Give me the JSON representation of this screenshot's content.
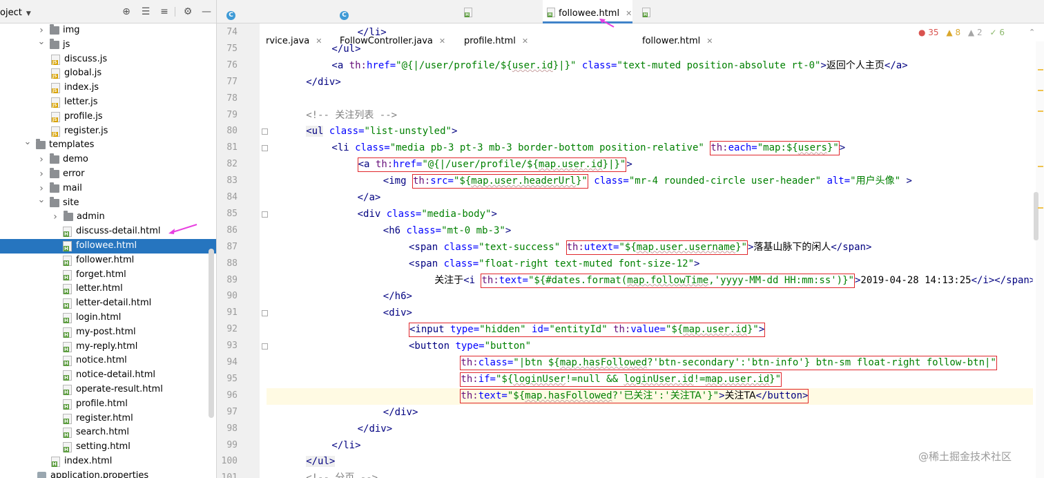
{
  "project_pane": {
    "title": "oject",
    "tree": [
      {
        "label": "img",
        "type": "folder",
        "level": 3,
        "expanded": false
      },
      {
        "label": "js",
        "type": "folder",
        "level": 3,
        "expanded": true
      },
      {
        "label": "discuss.js",
        "type": "js",
        "level": 4
      },
      {
        "label": "global.js",
        "type": "js",
        "level": 4
      },
      {
        "label": "index.js",
        "type": "js",
        "level": 4
      },
      {
        "label": "letter.js",
        "type": "js",
        "level": 4
      },
      {
        "label": "profile.js",
        "type": "js",
        "level": 4
      },
      {
        "label": "register.js",
        "type": "js",
        "level": 4
      },
      {
        "label": "templates",
        "type": "folder",
        "level": 2,
        "expanded": true
      },
      {
        "label": "demo",
        "type": "folder",
        "level": 3,
        "expanded": false
      },
      {
        "label": "error",
        "type": "folder",
        "level": 3,
        "expanded": false
      },
      {
        "label": "mail",
        "type": "folder",
        "level": 3,
        "expanded": false
      },
      {
        "label": "site",
        "type": "folder",
        "level": 3,
        "expanded": true
      },
      {
        "label": "admin",
        "type": "folder",
        "level": 4,
        "expanded": false
      },
      {
        "label": "discuss-detail.html",
        "type": "html",
        "level": 5
      },
      {
        "label": "followee.html",
        "type": "html",
        "level": 5,
        "selected": true
      },
      {
        "label": "follower.html",
        "type": "html",
        "level": 5
      },
      {
        "label": "forget.html",
        "type": "html",
        "level": 5
      },
      {
        "label": "letter.html",
        "type": "html",
        "level": 5
      },
      {
        "label": "letter-detail.html",
        "type": "html",
        "level": 5
      },
      {
        "label": "login.html",
        "type": "html",
        "level": 5
      },
      {
        "label": "my-post.html",
        "type": "html",
        "level": 5
      },
      {
        "label": "my-reply.html",
        "type": "html",
        "level": 5
      },
      {
        "label": "notice.html",
        "type": "html",
        "level": 5
      },
      {
        "label": "notice-detail.html",
        "type": "html",
        "level": 5
      },
      {
        "label": "operate-result.html",
        "type": "html",
        "level": 5
      },
      {
        "label": "profile.html",
        "type": "html",
        "level": 5
      },
      {
        "label": "register.html",
        "type": "html",
        "level": 5
      },
      {
        "label": "search.html",
        "type": "html",
        "level": 5
      },
      {
        "label": "setting.html",
        "type": "html",
        "level": 5
      },
      {
        "label": "index.html",
        "type": "html",
        "level": 4
      },
      {
        "label": "application.properties",
        "type": "properties",
        "level": 3
      }
    ]
  },
  "tabs": [
    {
      "label": "FollowService.java",
      "kind": "class"
    },
    {
      "label": "FollowController.java",
      "kind": "class"
    },
    {
      "label": "profile.html",
      "kind": "html"
    },
    {
      "label": "followee.html",
      "kind": "html",
      "active": true
    },
    {
      "label": "follower.html",
      "kind": "html"
    }
  ],
  "inspections": {
    "errors": "35",
    "warnings": "8",
    "weak_warnings": "2",
    "typos": "6"
  },
  "editor": {
    "current_line": "96",
    "lines": [
      {
        "n": "74",
        "indent": 3,
        "tokens": [
          [
            "tag",
            "</li>"
          ]
        ]
      },
      {
        "n": "75",
        "indent": 2,
        "tokens": [
          [
            "tag",
            "</ul>"
          ]
        ]
      },
      {
        "n": "76",
        "indent": 2,
        "tokens": [
          [
            "tag",
            "<a "
          ],
          [
            "thattr",
            "th:"
          ],
          [
            "attr",
            "href="
          ],
          [
            "str",
            "\"@{|/user/profile/${"
          ],
          [
            "str-w",
            "user.id"
          ],
          [
            "str",
            "}|}\""
          ],
          [
            "plain",
            " "
          ],
          [
            "attr",
            "class="
          ],
          [
            "str",
            "\"text-muted position-absolute rt-0\""
          ],
          [
            "tag",
            ">"
          ],
          [
            "zh",
            "返回个人主页"
          ],
          [
            "tag",
            "</a>"
          ]
        ]
      },
      {
        "n": "77",
        "indent": 1,
        "tokens": [
          [
            "tag",
            "</div>"
          ]
        ]
      },
      {
        "n": "78",
        "indent": 0,
        "tokens": []
      },
      {
        "n": "79",
        "indent": 1,
        "tokens": [
          [
            "cmt",
            "<!-- "
          ],
          [
            "cmtzh",
            "关注列表"
          ],
          [
            "cmt",
            " -->"
          ]
        ]
      },
      {
        "n": "80",
        "indent": 1,
        "tokens": [
          [
            "tagbg",
            "<ul"
          ],
          [
            "plain",
            " "
          ],
          [
            "attr",
            "class="
          ],
          [
            "str",
            "\"list-unstyled\""
          ],
          [
            "tag",
            ">"
          ]
        ]
      },
      {
        "n": "81",
        "indent": 2,
        "tokens": [
          [
            "tag",
            "<li "
          ],
          [
            "attr",
            "class="
          ],
          [
            "str",
            "\"media pb-3 pt-3 mb-3 border-bottom position-relative\""
          ],
          [
            "plain",
            " "
          ],
          [
            "hl",
            [
              [
                "thattr",
                "th:"
              ],
              [
                "attr",
                "each="
              ],
              [
                "str",
                "\"map:${"
              ],
              [
                "str-w",
                "users"
              ],
              [
                "str",
                "}\""
              ]
            ]
          ],
          [
            "tag",
            ">"
          ]
        ]
      },
      {
        "n": "82",
        "indent": 3,
        "tokens": [
          [
            "hl",
            [
              [
                "tag",
                "<a "
              ],
              [
                "thattr",
                "th:"
              ],
              [
                "attr",
                "href="
              ],
              [
                "str",
                "\"@{|/user/profile/${"
              ],
              [
                "str-w",
                "map.user.id"
              ],
              [
                "str",
                "}|}\""
              ]
            ]
          ],
          [
            "tag",
            ">"
          ]
        ]
      },
      {
        "n": "83",
        "indent": 4,
        "tokens": [
          [
            "tag",
            "<img "
          ],
          [
            "hl",
            [
              [
                "thattr",
                "th:"
              ],
              [
                "attr",
                "src="
              ],
              [
                "str",
                "\"${"
              ],
              [
                "str-w",
                "map.user.headerUrl"
              ],
              [
                "str",
                "}\""
              ]
            ]
          ],
          [
            "plain",
            " "
          ],
          [
            "attr",
            "class="
          ],
          [
            "str",
            "\"mr-4 rounded-circle user-header\""
          ],
          [
            "plain",
            " "
          ],
          [
            "attr",
            "alt="
          ],
          [
            "str",
            "\""
          ],
          [
            "strzh",
            "用户头像"
          ],
          [
            "str",
            "\""
          ],
          [
            "plain",
            " "
          ],
          [
            "tag",
            ">"
          ]
        ]
      },
      {
        "n": "84",
        "indent": 3,
        "tokens": [
          [
            "tag",
            "</a>"
          ]
        ]
      },
      {
        "n": "85",
        "indent": 3,
        "tokens": [
          [
            "tag",
            "<div "
          ],
          [
            "attr",
            "class="
          ],
          [
            "str",
            "\"media-body\""
          ],
          [
            "tag",
            ">"
          ]
        ]
      },
      {
        "n": "86",
        "indent": 4,
        "tokens": [
          [
            "tag",
            "<h6 "
          ],
          [
            "attr",
            "class="
          ],
          [
            "str",
            "\"mt-0 mb-3\""
          ],
          [
            "tag",
            ">"
          ]
        ]
      },
      {
        "n": "87",
        "indent": 5,
        "tokens": [
          [
            "tag",
            "<span "
          ],
          [
            "attr",
            "class="
          ],
          [
            "str",
            "\"text-success\""
          ],
          [
            "plain",
            " "
          ],
          [
            "hl",
            [
              [
                "thattr",
                "th:"
              ],
              [
                "attr",
                "utext="
              ],
              [
                "str",
                "\"${"
              ],
              [
                "str-w",
                "map.user.username"
              ],
              [
                "str",
                "}\""
              ]
            ]
          ],
          [
            "tag",
            ">"
          ],
          [
            "zh",
            "落基山脉下的闲人"
          ],
          [
            "tag",
            "</span>"
          ]
        ]
      },
      {
        "n": "88",
        "indent": 5,
        "tokens": [
          [
            "tag",
            "<span "
          ],
          [
            "attr",
            "class="
          ],
          [
            "str",
            "\"float-right text-muted font-size-12\""
          ],
          [
            "tag",
            ">"
          ]
        ]
      },
      {
        "n": "89",
        "indent": 6,
        "tokens": [
          [
            "zh",
            "关注于"
          ],
          [
            "tag",
            "<i "
          ],
          [
            "hl",
            [
              [
                "thattr",
                "th:"
              ],
              [
                "attr",
                "text="
              ],
              [
                "str",
                "\"${#dates.format("
              ],
              [
                "str-w",
                "map.followTime"
              ],
              [
                "str",
                ",'yyyy-MM-dd HH:mm:ss')}\""
              ]
            ]
          ],
          [
            "tag",
            ">"
          ],
          [
            "plain",
            "2019-04-28 14:13:25"
          ],
          [
            "tag",
            "</i></span>"
          ]
        ]
      },
      {
        "n": "90",
        "indent": 4,
        "tokens": [
          [
            "tag",
            "</h6>"
          ]
        ]
      },
      {
        "n": "91",
        "indent": 4,
        "tokens": [
          [
            "tag",
            "<div>"
          ]
        ]
      },
      {
        "n": "92",
        "indent": 5,
        "tokens": [
          [
            "hl",
            [
              [
                "tag",
                "<input "
              ],
              [
                "attr",
                "type="
              ],
              [
                "str",
                "\"hidden\""
              ],
              [
                "plain",
                " "
              ],
              [
                "attr",
                "id="
              ],
              [
                "str",
                "\"entityId\""
              ],
              [
                "plain",
                " "
              ],
              [
                "thattr",
                "th:"
              ],
              [
                "attr",
                "value="
              ],
              [
                "str",
                "\"${"
              ],
              [
                "str-w",
                "map.user.id"
              ],
              [
                "str",
                "}\""
              ],
              [
                "tag",
                ">"
              ]
            ]
          ]
        ]
      },
      {
        "n": "93",
        "indent": 5,
        "tokens": [
          [
            "tag",
            "<button "
          ],
          [
            "attr",
            "type="
          ],
          [
            "str",
            "\"button\""
          ]
        ]
      },
      {
        "n": "94",
        "indent": 7,
        "tokens": [
          [
            "hl",
            [
              [
                "thattr",
                "th:"
              ],
              [
                "attr",
                "class="
              ],
              [
                "str",
                "\"|btn ${"
              ],
              [
                "str-w",
                "map.hasFollowed"
              ],
              [
                "str",
                "?'btn-secondary':'btn-info'} btn-sm float-right follow-btn|\""
              ]
            ]
          ]
        ]
      },
      {
        "n": "95",
        "indent": 7,
        "tokens": [
          [
            "hl",
            [
              [
                "thattr",
                "th:"
              ],
              [
                "attr",
                "if="
              ],
              [
                "str",
                "\"${"
              ],
              [
                "str-w",
                "loginUser"
              ],
              [
                "str",
                "!=null && "
              ],
              [
                "str-w",
                "loginUser.id"
              ],
              [
                "str",
                "!="
              ],
              [
                "str-w",
                "map.user.id"
              ],
              [
                "str",
                "}\""
              ]
            ]
          ]
        ]
      },
      {
        "n": "96",
        "indent": 7,
        "tokens": [
          [
            "hl",
            [
              [
                "thattr",
                "th:"
              ],
              [
                "attr",
                "text="
              ],
              [
                "str",
                "\"${"
              ],
              [
                "str-w",
                "map.hasFollowed"
              ],
              [
                "str",
                "?'"
              ],
              [
                "strzh",
                "已关注"
              ],
              [
                "str",
                "':'"
              ],
              [
                "strzh",
                "关注TA"
              ],
              [
                "str",
                "'}\""
              ],
              [
                "tag",
                ">"
              ],
              [
                "zh",
                "关注TA"
              ],
              [
                "tag",
                "</button>"
              ]
            ]
          ]
        ]
      },
      {
        "n": "97",
        "indent": 4,
        "tokens": [
          [
            "tag",
            "</div>"
          ]
        ]
      },
      {
        "n": "98",
        "indent": 3,
        "tokens": [
          [
            "tag",
            "</div>"
          ]
        ]
      },
      {
        "n": "99",
        "indent": 2,
        "tokens": [
          [
            "tag",
            "</li>"
          ]
        ]
      },
      {
        "n": "100",
        "indent": 1,
        "tokens": [
          [
            "tagbg",
            "</ul>"
          ]
        ]
      },
      {
        "n": "101",
        "indent": 1,
        "tokens": [
          [
            "cmt",
            "<!-- "
          ],
          [
            "cmtzh",
            "分页"
          ],
          [
            "cmt",
            " -->"
          ]
        ]
      }
    ]
  },
  "watermark": "@稀土掘金技术社区",
  "colors": {
    "selection": "#2675bf",
    "highlight_box": "#e0262b",
    "annotation_arrow": "#e83fe0",
    "tab_underline": "#4083c9"
  }
}
